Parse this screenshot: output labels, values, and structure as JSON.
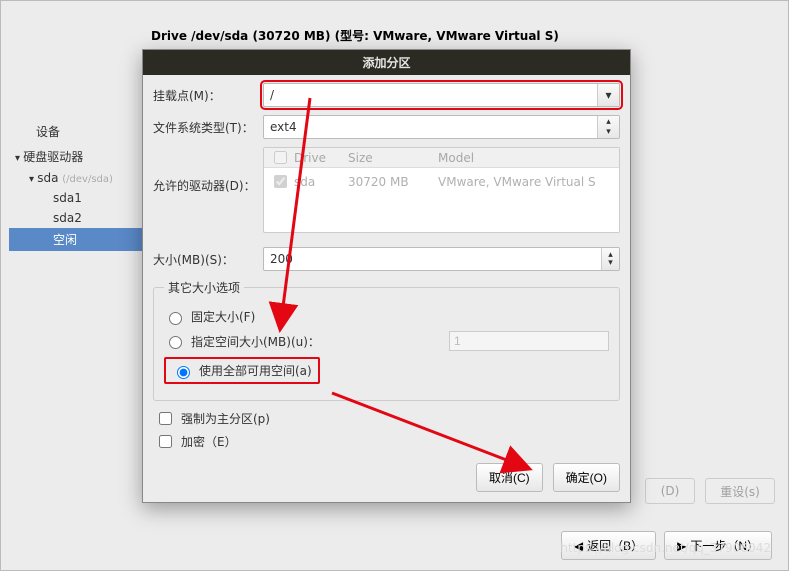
{
  "header": {
    "drive_label": "Drive /dev/sda (30720 MB) (型号: VMware, VMware Virtual S)"
  },
  "device_col_header": "设备",
  "tree": {
    "root": "硬盘驱动器",
    "disk": "sda",
    "disk_path": "(/dev/sda)",
    "p1": "sda1",
    "p2": "sda2",
    "free": "空闲"
  },
  "disabled": {
    "create_raid": "(D)",
    "reset": "重设(s)"
  },
  "bottom": {
    "back": "返回（B）",
    "next": "下一步（N）"
  },
  "dialog": {
    "title": "添加分区",
    "mount_label": "挂载点(M)：",
    "mount_value": "/",
    "fs_label": "文件系统类型(T)：",
    "fs_value": "ext4",
    "allow_label": "允许的驱动器(D)：",
    "table": {
      "h_drive": "Drive",
      "h_size": "Size",
      "h_model": "Model",
      "row_drive": "sda",
      "row_size": "30720 MB",
      "row_model": "VMware, VMware Virtual S"
    },
    "size_label": "大小(MB)(S)：",
    "size_value": "200",
    "other_legend": "其它大小选项",
    "opt_fixed": "固定大小(F)",
    "opt_specify": "指定空间大小(MB)(u)：",
    "opt_specify_value": "1",
    "opt_all": "使用全部可用空间(a)",
    "force_primary": "强制为主分区(p)",
    "encrypt": "加密（E）",
    "cancel": "取消(C)",
    "ok": "确定(O)"
  },
  "watermark": "https://blog.csdn.net/qq_37908042"
}
